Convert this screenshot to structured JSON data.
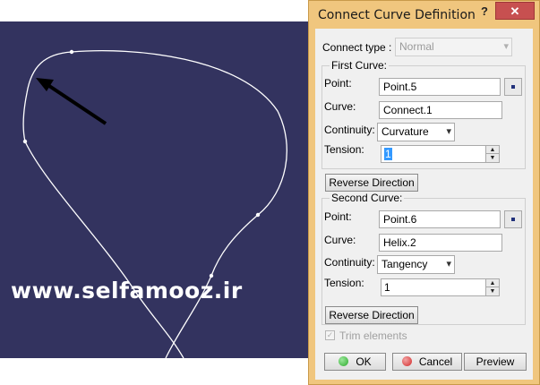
{
  "dialog": {
    "title": "Connect Curve Definition",
    "help_label": "?",
    "close_label": "✕"
  },
  "connect_type": {
    "label": "Connect type :",
    "value": "Normal"
  },
  "first_curve": {
    "group_label": "First Curve:",
    "point_label": "Point:",
    "point_value": "Point.5",
    "curve_label": "Curve:",
    "curve_value": "Connect.1",
    "continuity_label": "Continuity:",
    "continuity_value": "Curvature",
    "tension_label": "Tension:",
    "tension_value": "1",
    "reverse_label": "Reverse Direction"
  },
  "second_curve": {
    "group_label": "Second Curve:",
    "point_label": "Point:",
    "point_value": "Point.6",
    "curve_label": "Curve:",
    "curve_value": "Helix.2",
    "continuity_label": "Continuity:",
    "continuity_value": "Tangency",
    "tension_label": "Tension:",
    "tension_value": "1",
    "reverse_label": "Reverse Direction"
  },
  "trim": {
    "label": "Trim elements",
    "checked": true
  },
  "buttons": {
    "ok_label": "OK",
    "cancel_label": "Cancel",
    "preview_label": "Preview"
  },
  "viewport": {
    "watermark": "www.selfamooz.ir",
    "background_color": "#33335f"
  },
  "colors": {
    "dialog_frame": "#f0c67e",
    "close_button": "#c75050",
    "ok_icon": "#2eaa2e",
    "cancel_icon": "#d22a2a"
  }
}
